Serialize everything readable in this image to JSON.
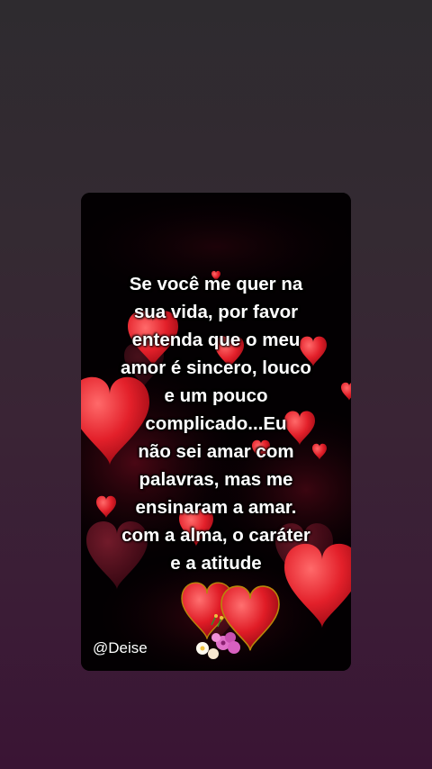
{
  "post": {
    "quote_lines": [
      "Se você me quer na",
      "sua vida, por favor",
      "entenda que o meu",
      "amor é sincero, louco",
      "e um pouco",
      "complicado...Eu",
      "não sei amar com",
      "palavras, mas me",
      "ensinaram a amar.",
      "com a alma, o caráter",
      "e a atitude"
    ],
    "signature": "@Deise"
  },
  "colors": {
    "page_background_top": "#2e2b2f",
    "page_background_bottom": "#3a1434",
    "card_background": "#030002",
    "heart_red": "#e8202a",
    "text": "#ffffff"
  },
  "decorations": {
    "hearts-icon": "red hearts",
    "flowers-icon": "pink and white flower bouquet"
  }
}
